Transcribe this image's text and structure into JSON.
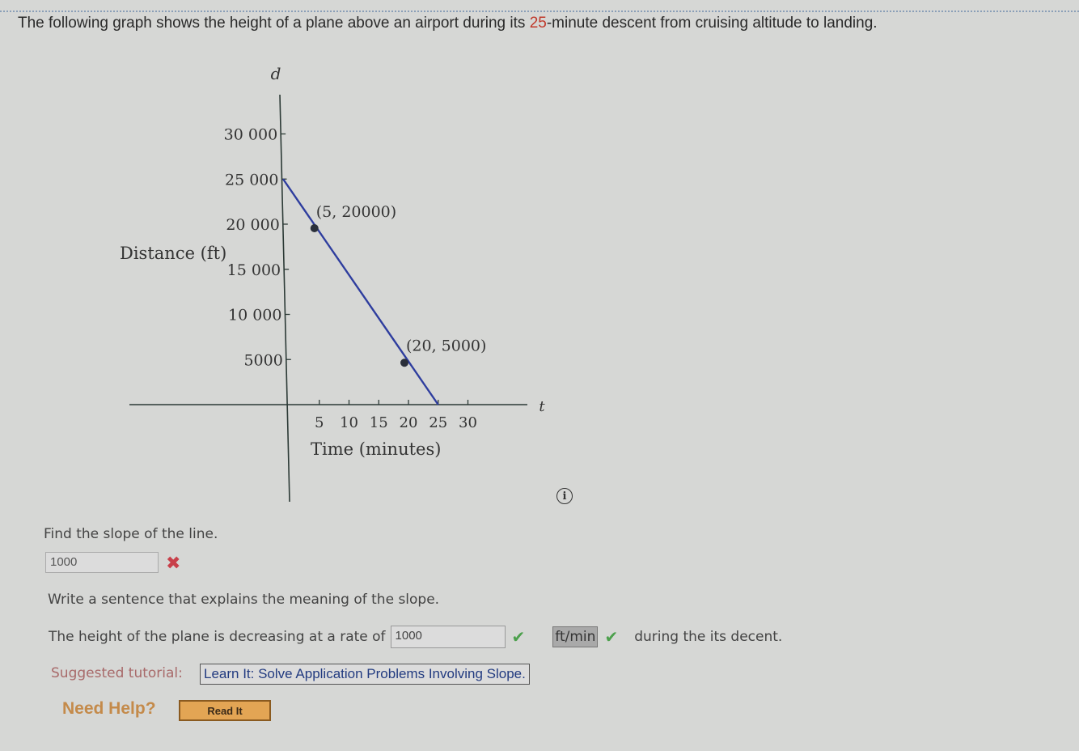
{
  "question": {
    "before": "The following graph shows the height of a plane above an airport during its ",
    "highlight": "25",
    "after": "-minute descent from cruising altitude to landing."
  },
  "chart_data": {
    "type": "line",
    "title": "",
    "xlabel": "Time (minutes)",
    "ylabel": "Distance (ft)",
    "x_axis_var": "t",
    "y_axis_var": "d",
    "xlim": [
      0,
      30
    ],
    "ylim": [
      0,
      30000
    ],
    "x_ticks": [
      5,
      10,
      15,
      20,
      25,
      30
    ],
    "x_tick_labels": [
      "5",
      "10",
      "15",
      "20",
      "25",
      "30"
    ],
    "y_ticks": [
      5000,
      10000,
      15000,
      20000,
      25000,
      30000
    ],
    "y_tick_labels": [
      "5000",
      "10 000",
      "15 000",
      "20 000",
      "25 000",
      "30 000"
    ],
    "grid": false,
    "series": [
      {
        "name": "height",
        "color": "#2e3d9e",
        "points": [
          [
            0,
            25000
          ],
          [
            25,
            0
          ]
        ]
      }
    ],
    "marked_points": [
      {
        "x": 5,
        "y": 20000,
        "label": "(5, 20000)"
      },
      {
        "x": 20,
        "y": 5000,
        "label": "(20, 5000)"
      }
    ]
  },
  "parts": {
    "find_slope": "Find the slope of the line.",
    "slope_answer": "1000",
    "slope_status": "incorrect",
    "slope_status_icon": "✖",
    "write_sentence": "Write a sentence that explains the meaning of the slope.",
    "sentence_before": "The height of the plane is decreasing at a rate of",
    "rate_answer": "1000",
    "rate_status_icon": "✔",
    "unit_selected": "ft/min",
    "unit_status_icon": "✔",
    "sentence_after": "during the its decent."
  },
  "tutorial": {
    "label": "Suggested tutorial:",
    "link": "Learn It: Solve Application Problems Involving Slope."
  },
  "help": {
    "label": "Need Help?",
    "button": "Read It"
  },
  "info_icon": "i"
}
